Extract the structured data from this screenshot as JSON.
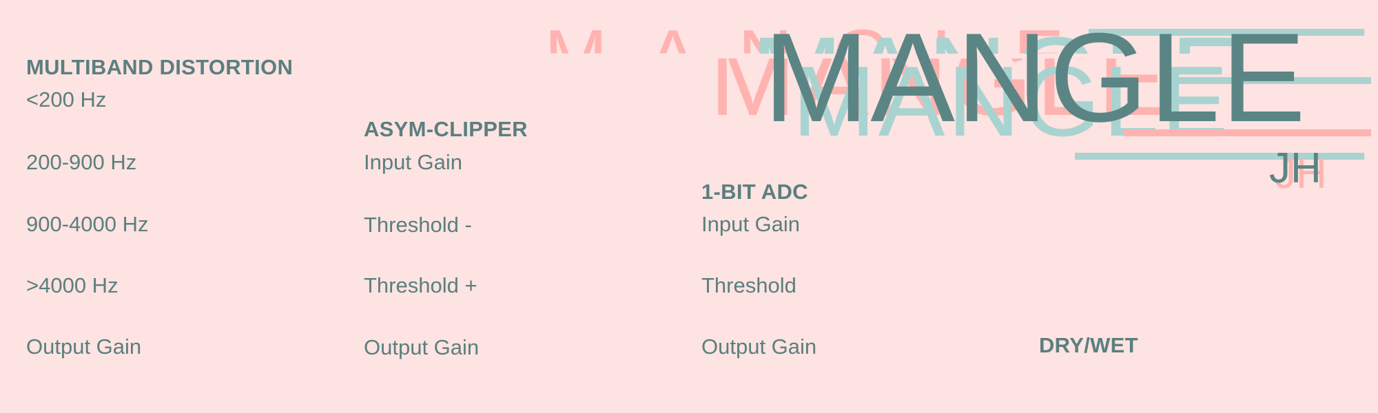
{
  "logo": {
    "title": "MANGLE",
    "author": "JH"
  },
  "multiband": {
    "title": "MULTIBAND DISTORTION",
    "params": [
      "<200 Hz",
      "200-900 Hz",
      "900-4000 Hz",
      ">4000 Hz",
      "Output Gain"
    ]
  },
  "asym_clipper": {
    "title": "ASYM-CLIPPER",
    "params": [
      "Input Gain",
      "Threshold -",
      "Threshold +",
      "Output Gain"
    ]
  },
  "one_bit_adc": {
    "title": "1-BIT ADC",
    "params": [
      "Input Gain",
      "Threshold",
      "Output Gain"
    ]
  },
  "dry_wet": {
    "title": "DRY/WET"
  },
  "colors": {
    "background": "#fde3e2",
    "text": "#5a7f7e",
    "ghost_pink": "#ffb3b1",
    "ghost_teal": "#a9d3d0"
  }
}
